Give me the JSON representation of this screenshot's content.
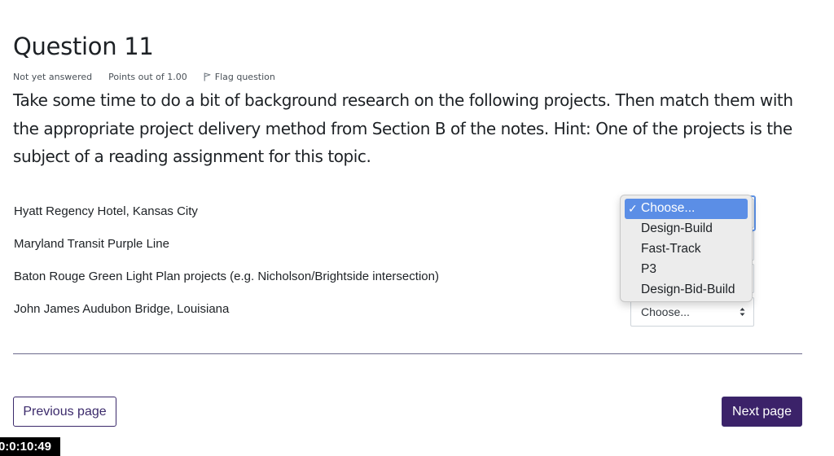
{
  "question": {
    "title": "Question 11",
    "status": "Not yet answered",
    "points": "Points out of 1.00",
    "flag_label": "Flag question",
    "text": "Take some time to do a bit of background research on the following projects. Then match them with the appropriate project delivery method from Section B of the notes. Hint: One of the projects is the subject of a reading assignment for this topic."
  },
  "matching": {
    "items": [
      {
        "label": "Hyatt Regency Hotel, Kansas City"
      },
      {
        "label": "Maryland Transit Purple Line"
      },
      {
        "label": "Baton Rouge Green Light Plan projects (e.g. Nicholson/Brightside intersection)"
      },
      {
        "label": "John James Audubon Bridge, Louisiana"
      }
    ],
    "select_value": "Choose..."
  },
  "dropdown": {
    "options": [
      "Choose...",
      "Design-Build",
      "Fast-Track",
      "P3",
      "Design-Bid-Build"
    ],
    "selected_index": 0,
    "check_mark": "✓"
  },
  "nav": {
    "previous_label": "Previous page",
    "next_label": "Next page"
  },
  "timer": {
    "value": "0:0:10:49"
  },
  "colors": {
    "primary": "#3b2269",
    "dropdown_highlight": "#5b8ee6",
    "focus_ring": "#5e93e8"
  }
}
